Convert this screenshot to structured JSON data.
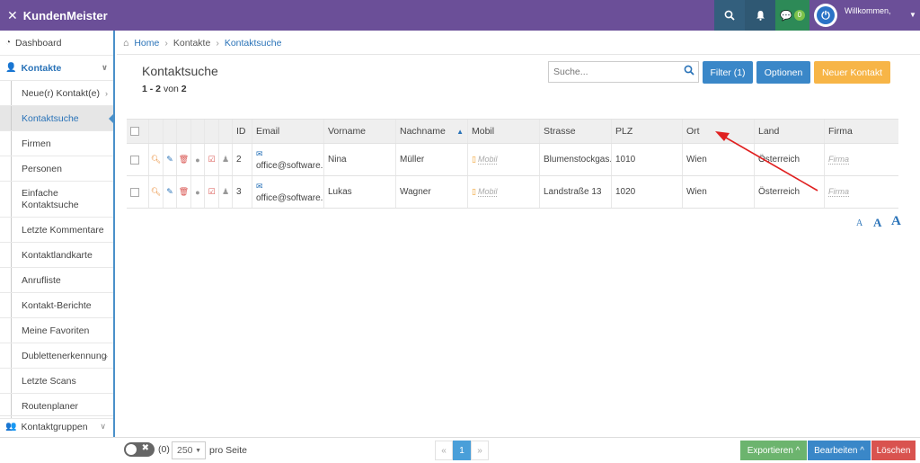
{
  "topbar": {
    "app_name": "KundenMeister",
    "chat_count": "0",
    "welcome": "Willkommen,"
  },
  "sidebar": {
    "items": [
      {
        "label": "Dashboard"
      },
      {
        "label": "Kontakte"
      },
      {
        "label": "Neue(r) Kontakt(e)"
      },
      {
        "label": "Kontaktsuche"
      },
      {
        "label": "Firmen"
      },
      {
        "label": "Personen"
      },
      {
        "label": "Einfache Kontaktsuche"
      },
      {
        "label": "Letzte Kommentare"
      },
      {
        "label": "Kontaktlandkarte"
      },
      {
        "label": "Anrufliste"
      },
      {
        "label": "Kontakt-Berichte"
      },
      {
        "label": "Meine Favoriten"
      },
      {
        "label": "Dublettenerkennung"
      },
      {
        "label": "Letzte Scans"
      },
      {
        "label": "Routenplaner"
      }
    ],
    "group": "Kontaktgruppen"
  },
  "breadcrumb": {
    "home": "Home",
    "kontakte": "Kontakte",
    "current": "Kontaktsuche"
  },
  "page": {
    "title": "Kontaktsuche",
    "range": "1 - 2",
    "von": "von",
    "total": "2"
  },
  "search": {
    "placeholder": "Suche..."
  },
  "buttons": {
    "filter": "Filter (1)",
    "options": "Optionen",
    "new": "Neuer Kontakt"
  },
  "table": {
    "headers": {
      "id": "ID",
      "email": "Email",
      "vorname": "Vorname",
      "nachname": "Nachname",
      "mobil": "Mobil",
      "strasse": "Strasse",
      "plz": "PLZ",
      "ort": "Ort",
      "land": "Land",
      "firma": "Firma"
    },
    "rows": [
      {
        "id": "2",
        "email": "office@software...",
        "vorname": "Nina",
        "nachname": "Müller",
        "mobil": "Mobil",
        "strasse": "Blumenstockgas...",
        "plz": "1010",
        "ort": "Wien",
        "land": "Österreich",
        "firma": "Firma"
      },
      {
        "id": "3",
        "email": "office@software...",
        "vorname": "Lukas",
        "nachname": "Wagner",
        "mobil": "Mobil",
        "strasse": "Landstraße 13",
        "plz": "1020",
        "ort": "Wien",
        "land": "Österreich",
        "firma": "Firma"
      }
    ]
  },
  "font_size_labels": {
    "small": "A",
    "medium": "A",
    "large": "A"
  },
  "footer": {
    "toggle_label": "✖",
    "toggle_count": "(0)",
    "per_page_value": "250",
    "per_page_label": "pro Seite",
    "prev": "«",
    "page": "1",
    "next": "»",
    "export": "Exportieren ^",
    "edit": "Bearbeiten ^",
    "delete": "Löschen"
  },
  "colors": {
    "topbar": "#6b4f98",
    "primary": "#3a87c8",
    "accent_orange": "#f7b547",
    "export_green": "#6cb46e",
    "delete_red": "#d9534f",
    "annotation_arrow": "#e02020"
  }
}
